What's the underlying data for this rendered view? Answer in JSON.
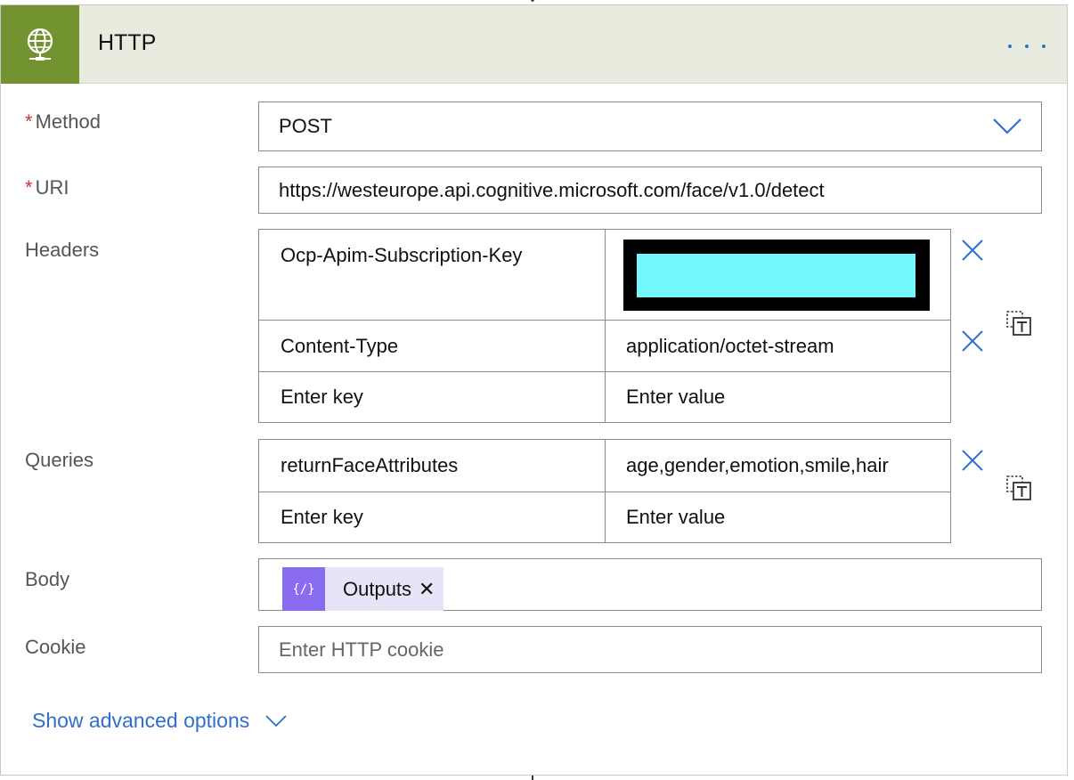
{
  "header": {
    "title": "HTTP",
    "icon": "globe-icon",
    "color": "#739331"
  },
  "fields": {
    "method": {
      "label": "Method",
      "required_mark": "*",
      "value": "POST"
    },
    "uri": {
      "label": "URI",
      "required_mark": "*",
      "value": "https://westeurope.api.cognitive.microsoft.com/face/v1.0/detect"
    },
    "headers": {
      "label": "Headers",
      "rows": [
        {
          "key": "Ocp-Apim-Subscription-Key",
          "value": ""
        },
        {
          "key": "Content-Type",
          "value": "application/octet-stream"
        }
      ],
      "key_placeholder": "Enter key",
      "value_placeholder": "Enter value"
    },
    "queries": {
      "label": "Queries",
      "rows": [
        {
          "key": "returnFaceAttributes",
          "value": "age,gender,emotion,smile,hair"
        }
      ],
      "key_placeholder": "Enter key",
      "value_placeholder": "Enter value"
    },
    "body": {
      "label": "Body",
      "token": {
        "label": "Outputs",
        "icon": "expression-icon",
        "close": "✕"
      }
    },
    "cookie": {
      "label": "Cookie",
      "placeholder": "Enter HTTP cookie"
    }
  },
  "advanced": {
    "label": "Show advanced options"
  },
  "colors": {
    "accent": "#2f6fcf",
    "required": "#d13438",
    "redaction": "#72f8fc",
    "token": "#8a6cf0"
  }
}
